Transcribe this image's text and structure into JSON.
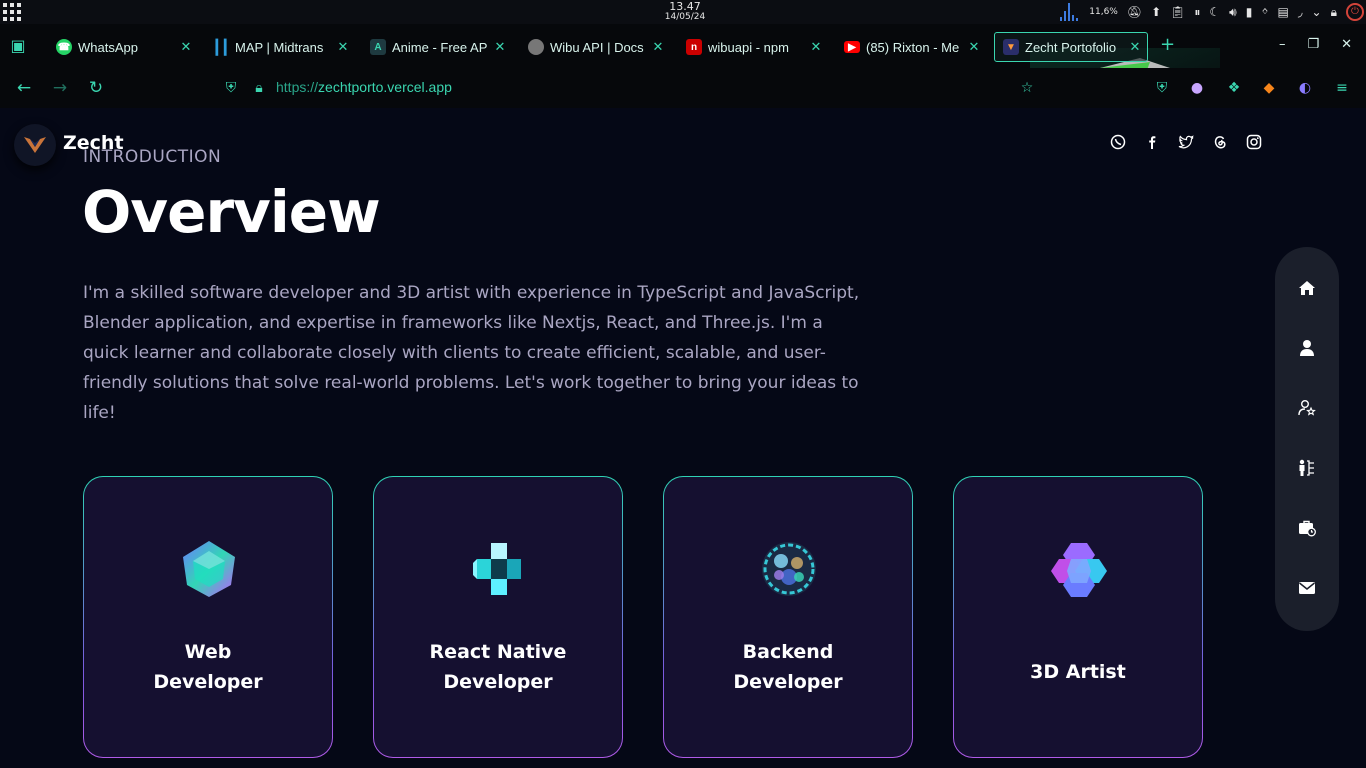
{
  "system_bar": {
    "time": "13.47",
    "date": "14/05/24",
    "cpu_percent": "11,6%"
  },
  "tabs": [
    {
      "label": "WhatsApp",
      "favicon": "whatsapp-icon",
      "color": "#25d366"
    },
    {
      "label": "MAP | Midtrans",
      "favicon": "midtrans-icon",
      "color": "#2d9cdb"
    },
    {
      "label": "Anime - Free AP",
      "favicon": "anime-api-icon",
      "color": "#3ad6b0"
    },
    {
      "label": "Wibu API | Docs",
      "favicon": "wibu-avatar-icon",
      "color": "#888888"
    },
    {
      "label": "wibuapi - npm",
      "favicon": "npm-icon",
      "color": "#cb0000"
    },
    {
      "label": "(85) Rixton - Me",
      "favicon": "youtube-icon",
      "color": "#ff0000"
    },
    {
      "label": "Zecht Portofolio",
      "favicon": "zecht-icon",
      "color": "#3b3f8f",
      "active": true
    }
  ],
  "address_bar": {
    "scheme": "https://",
    "host": "zechtporto.vercel.app"
  },
  "site": {
    "brand": "Zecht",
    "intro_label": "INTRODUCTION",
    "title": "Overview",
    "paragraph": "I'm a skilled software developer and 3D artist with experience in TypeScript and JavaScript, Blender application, and expertise in frameworks like Nextjs, React, and Three.js. I'm a quick learner and collaborate closely with clients to create efficient, scalable, and user-friendly solutions that solve real-world problems. Let's work together to bring your ideas to life!",
    "socials": [
      "whatsapp-icon",
      "facebook-icon",
      "twitter-icon",
      "threads-icon",
      "instagram-icon"
    ],
    "side_nav": [
      "home-icon",
      "user-icon",
      "user-star-icon",
      "skills-tree-icon",
      "briefcase-clock-icon",
      "mail-icon"
    ],
    "cards": [
      {
        "title": "Web\nDeveloper",
        "icon": "web-developer-3d-icon"
      },
      {
        "title": "React Native\nDeveloper",
        "icon": "react-native-3d-icon"
      },
      {
        "title": "Backend\nDeveloper",
        "icon": "backend-3d-icon"
      },
      {
        "title": "3D Artist",
        "icon": "3d-artist-icon"
      }
    ]
  },
  "colors": {
    "accent": "#3ad6b0",
    "page_bg": "#050816",
    "card_bg": "#151030",
    "secondary_text": "#aaa6c3"
  }
}
